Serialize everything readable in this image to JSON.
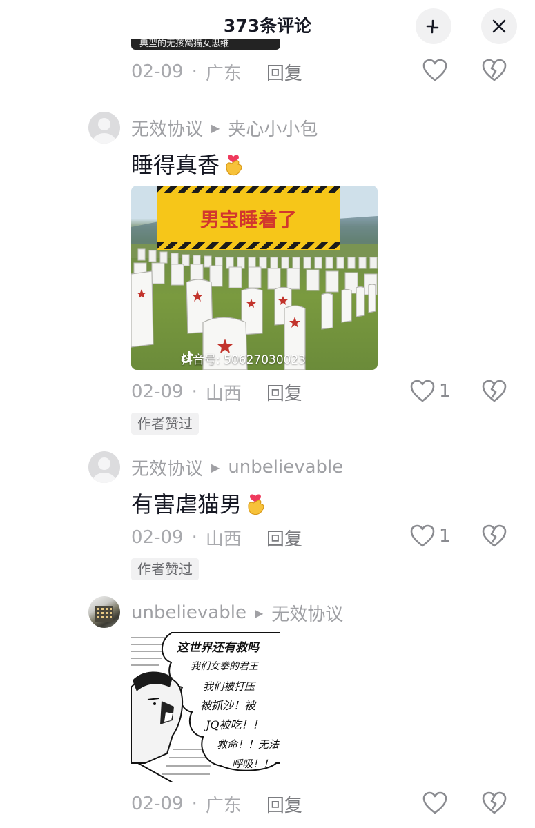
{
  "header": {
    "title": "373条评论"
  },
  "prev_comment": {
    "banner_text": "典型的无孩窝猫女思维",
    "date": "02-09",
    "separator": "·",
    "location": "广东",
    "reply_label": "回复"
  },
  "comments": [
    {
      "author": "无效协议",
      "reply_to": "夹心小小包",
      "text": "睡得真香",
      "image": {
        "banner_text": "男宝睡着了",
        "watermark": "抖音号: 50627030023"
      },
      "date": "02-09",
      "separator": "·",
      "location": "山西",
      "reply_label": "回复",
      "likes": "1",
      "author_liked_label": "作者赞过"
    },
    {
      "author": "无效协议",
      "reply_to": "unbelievable",
      "text": "有害虐猫男",
      "date": "02-09",
      "separator": "·",
      "location": "山西",
      "reply_label": "回复",
      "likes": "1",
      "author_liked_label": "作者赞过"
    },
    {
      "author": "unbelievable",
      "reply_to": "无效协议",
      "image": {
        "lines": [
          "这世界还有救吗",
          "我们女拳的君王",
          "我们被打压",
          "被抓沙！被",
          "JQ被吃！！",
          "救命！！无法",
          "呼吸！！"
        ]
      },
      "date": "02-09",
      "separator": "·",
      "location": "广东",
      "reply_label": "回复"
    }
  ],
  "icons": {
    "collapse": "collapse-arrows-icon",
    "close": "close-icon",
    "like": "heart-outline-icon",
    "dislike": "broken-heart-icon",
    "reply_arrow": "play-triangle-icon",
    "emoji": "finger-heart-emoji-icon",
    "douyin": "douyin-logo-icon"
  },
  "colors": {
    "text_primary": "#161823",
    "text_secondary": "#a8a9ad",
    "hazard_yellow": "#f6c619",
    "hazard_text": "#d2372d"
  }
}
